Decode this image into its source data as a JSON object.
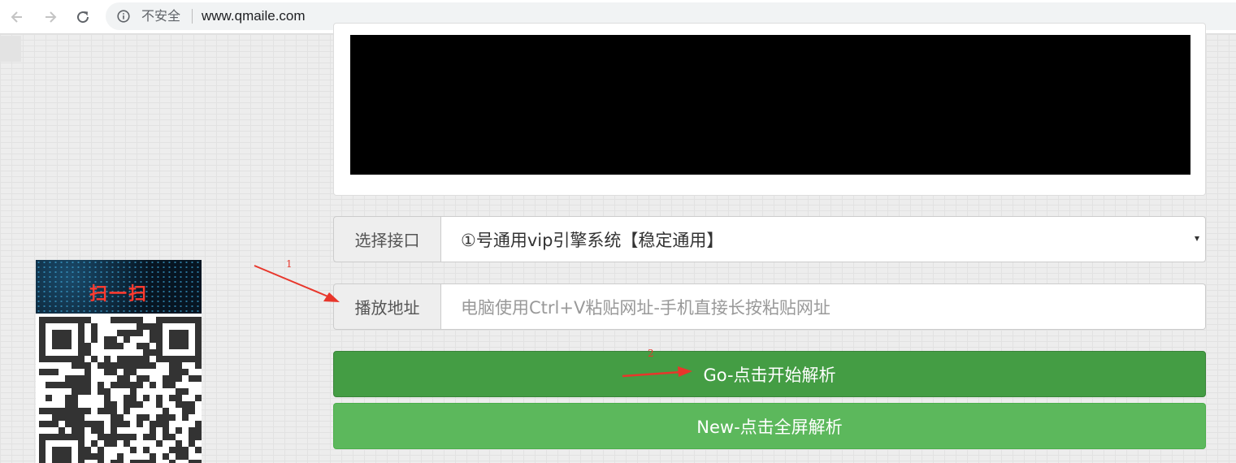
{
  "browser": {
    "back_icon": "back-arrow-icon",
    "forward_icon": "forward-arrow-icon",
    "reload_icon": "reload-icon",
    "security_icon": "info-icon",
    "security_label": "不安全",
    "url": "www.qmaile.com"
  },
  "qr": {
    "title": "扫一扫"
  },
  "form": {
    "interface_label": "选择接口",
    "interface_selected": "①号通用vip引擎系统【稳定通用】",
    "address_label": "播放地址",
    "address_placeholder": "电脑使用Ctrl+V粘贴网址-手机直接长按粘贴网址",
    "address_value": ""
  },
  "buttons": {
    "go_label": "Go-点击开始解析",
    "new_label": "New-点击全屏解析"
  },
  "annotations": {
    "marker_1": "1",
    "marker_2": "2",
    "color": "#e8362b"
  },
  "colors": {
    "go_button": "#449d44",
    "new_button": "#5cb85c",
    "player_bg": "#000000"
  }
}
